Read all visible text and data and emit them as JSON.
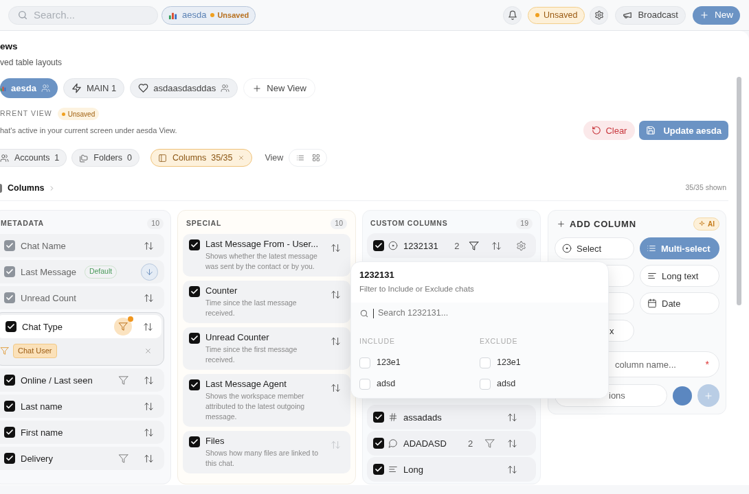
{
  "topbar": {
    "search_placeholder": "Search...",
    "view_chip": {
      "name": "aesda",
      "status": "Unsaved"
    },
    "status_badge": "Unsaved",
    "broadcast": "Broadcast",
    "new": "New"
  },
  "header": {
    "title": "ews",
    "subtitle": "ved table layouts"
  },
  "views": [
    {
      "label": "aesda",
      "kind": "chart",
      "shared": true,
      "selected": true
    },
    {
      "label": "MAIN 1",
      "kind": "bolt",
      "shared": false,
      "selected": false
    },
    {
      "label": "asdaasdasddas",
      "kind": "heart",
      "shared": true,
      "selected": false
    }
  ],
  "new_view": "New View",
  "current_view": {
    "label": "RRENT VIEW",
    "status": "Unsaved",
    "description": "hat's active in your current screen under aesda View.",
    "clear": "Clear",
    "update": "Update aesda"
  },
  "filters": [
    {
      "kind": "accounts",
      "label": "Accounts",
      "count": "1",
      "active": false
    },
    {
      "kind": "folders",
      "label": "Folders",
      "count": "0",
      "active": false
    },
    {
      "kind": "columns",
      "label": "Columns",
      "count": "35/35",
      "active": true
    }
  ],
  "view_label": "View",
  "view_modes": [
    {
      "kind": "list",
      "selected": false
    },
    {
      "kind": "grid",
      "selected": false
    }
  ],
  "breadcrumb": "Columns",
  "shown": "35/35 shown",
  "metadata": {
    "title": "METADATA",
    "count": "10",
    "items": [
      {
        "label": "Chat Name",
        "checked": true,
        "locked": true,
        "filterable": false
      },
      {
        "label": "Last Message",
        "checked": true,
        "locked": true,
        "filterable": false,
        "badge": "Default",
        "sort_active": true
      },
      {
        "label": "Unread Count",
        "checked": true,
        "locked": true,
        "filterable": false
      },
      {
        "label": "Chat Type",
        "checked": true,
        "locked": false,
        "filterable": true,
        "filter_active": true,
        "filter_values": [
          "Chat User"
        ]
      },
      {
        "label": "Online / Last seen",
        "checked": true,
        "locked": false,
        "filterable": true
      },
      {
        "label": "Last name",
        "checked": true,
        "locked": false,
        "filterable": false
      },
      {
        "label": "First name",
        "checked": true,
        "locked": false,
        "filterable": false
      },
      {
        "label": "Delivery",
        "checked": true,
        "locked": false,
        "filterable": true
      }
    ]
  },
  "special": {
    "title": "SPECIAL",
    "count": "10",
    "items": [
      {
        "title": "Last Message From - User...",
        "description": "Shows whether the latest message was sent by the contact or by you.",
        "checked": true,
        "sortable": true
      },
      {
        "title": "Counter",
        "description": "Time since the last message received.",
        "checked": true,
        "sortable": true
      },
      {
        "title": "Unread Counter",
        "description": "Time since the first message received.",
        "checked": true,
        "sortable": true
      },
      {
        "title": "Last Message Agent",
        "description": "Shows the workspace member attributed to the latest outgoing message.",
        "checked": true,
        "sortable": true
      },
      {
        "title": "Files",
        "description": "Shows how many files are linked to this chat.",
        "checked": true,
        "sortable": false
      }
    ]
  },
  "custom": {
    "title": "CUSTOM COLUMNS",
    "count": "19",
    "items": [
      {
        "label": "1232131",
        "kind": "select",
        "checked": true,
        "count": "2",
        "filterable": true,
        "settings": true
      },
      {
        "label": "assadads",
        "kind": "number",
        "checked": true,
        "filterable": false,
        "settings": false
      },
      {
        "label": "ADADASD",
        "kind": "text",
        "checked": true,
        "count": "2",
        "filterable": true,
        "settings": false
      },
      {
        "label": "Long",
        "kind": "long_text",
        "checked": true,
        "filterable": false,
        "settings": false
      }
    ]
  },
  "add_column": {
    "title": "ADD COLUMN",
    "ai": "AI",
    "types": [
      {
        "label": "Select",
        "kind": "select",
        "selected": false
      },
      {
        "label": "Multi-select",
        "kind": "multi_select",
        "selected": true
      },
      {
        "selected": false
      },
      {
        "label": "Long text",
        "kind": "long_text",
        "selected": false
      },
      {
        "selected": false
      },
      {
        "label": "Date",
        "kind": "date",
        "selected": false
      },
      {
        "label": "x",
        "selected": false
      }
    ],
    "name_placeholder": "column name...",
    "required_mark": "*",
    "options_placeholder": "ions",
    "color": "#5b87c0"
  },
  "popover": {
    "title": "1232131",
    "subtitle": "Filter to Include or Exclude chats",
    "search_placeholder": "Search 1232131...",
    "groups": [
      {
        "label": "INCLUDE",
        "options": [
          {
            "label": "123e1",
            "checked": false
          },
          {
            "label": "adsd",
            "checked": false
          }
        ]
      },
      {
        "label": "EXCLUDE",
        "options": [
          {
            "label": "123e1",
            "checked": false
          },
          {
            "label": "adsd",
            "checked": false
          }
        ]
      }
    ]
  }
}
